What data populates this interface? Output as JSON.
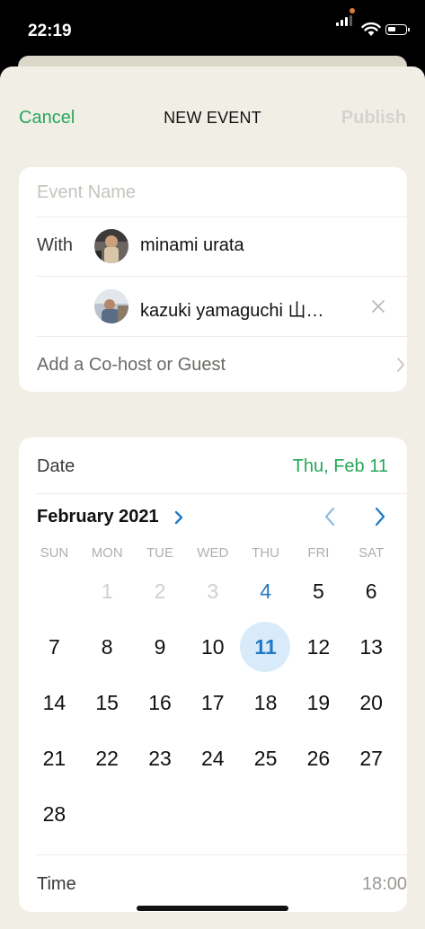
{
  "status": {
    "time": "22:19"
  },
  "nav": {
    "cancel": "Cancel",
    "title": "NEW EVENT",
    "publish": "Publish"
  },
  "event": {
    "name_placeholder": "Event Name",
    "with_label": "With",
    "guests": [
      {
        "name": "minami urata"
      },
      {
        "name": "kazuki yamaguchi 山…"
      }
    ],
    "add_guest_label": "Add a Co-host or Guest"
  },
  "date": {
    "label": "Date",
    "value": "Thu, Feb 11"
  },
  "calendar": {
    "month_label": "February 2021",
    "weekdays": [
      "SUN",
      "MON",
      "TUE",
      "WED",
      "THU",
      "FRI",
      "SAT"
    ],
    "first_weekday_index": 1,
    "days_in_month": 28,
    "today": 4,
    "selected": 11
  },
  "time": {
    "label": "Time",
    "value": "18:00"
  },
  "colors": {
    "accent_green": "#27a659",
    "accent_blue": "#1f79c4",
    "selected_bg": "#d9ebfa",
    "sheet_bg": "#f1efe5"
  },
  "icons": [
    "cellular-signal-icon",
    "wifi-icon",
    "battery-icon",
    "chevron-right-icon",
    "chevron-left-icon",
    "close-icon"
  ]
}
